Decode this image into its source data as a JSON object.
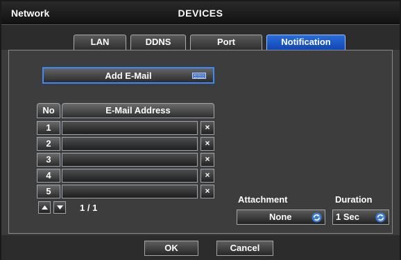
{
  "header": {
    "section": "Network",
    "title": "DEVICES"
  },
  "tabs": [
    {
      "label": "LAN",
      "active": false
    },
    {
      "label": "DDNS",
      "active": false
    },
    {
      "label": "Port",
      "active": false
    },
    {
      "label": "Notification",
      "active": true
    }
  ],
  "email": {
    "add_button_label": "Add E-Mail",
    "columns": {
      "no": "No",
      "address": "E-Mail Address"
    },
    "rows": [
      {
        "no": "1",
        "address": "",
        "delete": "×"
      },
      {
        "no": "2",
        "address": "",
        "delete": "×"
      },
      {
        "no": "3",
        "address": "",
        "delete": "×"
      },
      {
        "no": "4",
        "address": "",
        "delete": "×"
      },
      {
        "no": "5",
        "address": "",
        "delete": "×"
      }
    ],
    "page_indicator": "1 / 1"
  },
  "attachment": {
    "label": "Attachment",
    "value": "None"
  },
  "duration": {
    "label": "Duration",
    "value": "1 Sec"
  },
  "footer": {
    "ok_label": "OK",
    "cancel_label": "Cancel"
  },
  "colors": {
    "accent": "#1e5bd0",
    "window_bg": "#3d3d3d"
  },
  "icons": {
    "keyboard": "keyboard-icon",
    "refresh": "refresh-icon",
    "up": "arrow-up-icon",
    "down": "arrow-down-icon",
    "delete": "close-icon"
  }
}
